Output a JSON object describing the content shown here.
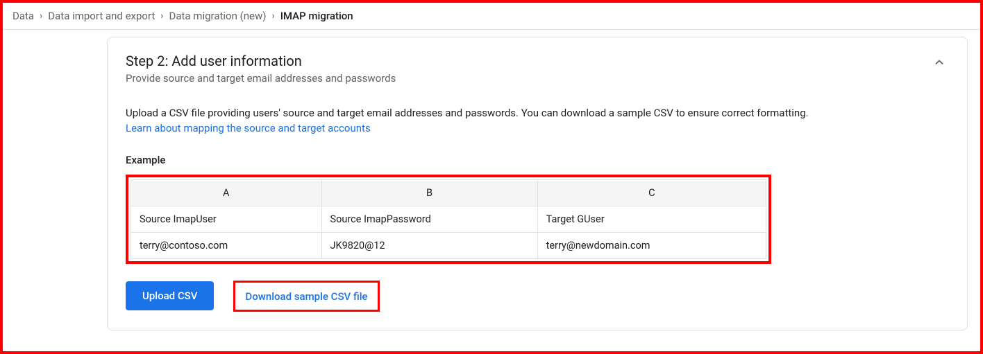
{
  "breadcrumb": {
    "items": [
      {
        "label": "Data"
      },
      {
        "label": "Data import and export"
      },
      {
        "label": "Data migration (new)"
      },
      {
        "label": "IMAP migration"
      }
    ]
  },
  "card": {
    "title": "Step 2: Add user information",
    "subtitle": "Provide source and target email addresses and passwords",
    "description": "Upload a CSV file providing users' source and target email addresses and passwords. You can download a sample CSV to ensure correct formatting.",
    "learn_link": "Learn about mapping the source and target accounts",
    "example_label": "Example",
    "table": {
      "columns": [
        "A",
        "B",
        "C"
      ],
      "rows": [
        [
          "Source ImapUser",
          "Source ImapPassword",
          "Target GUser"
        ],
        [
          "terry@contoso.com",
          "JK9820@12",
          "terry@newdomain.com"
        ]
      ]
    },
    "upload_label": "Upload CSV",
    "download_label": "Download sample CSV file"
  }
}
